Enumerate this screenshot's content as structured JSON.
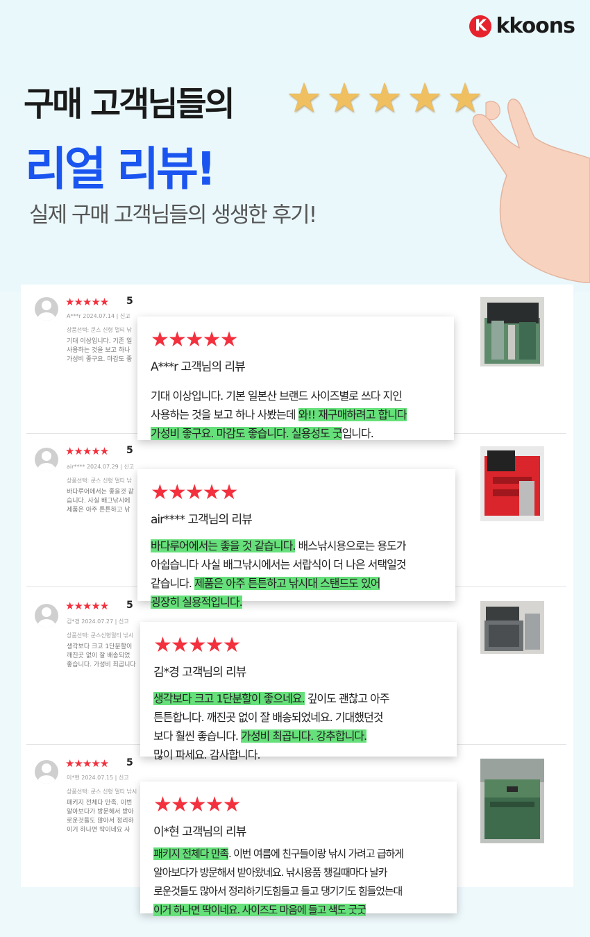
{
  "brand": {
    "logo_mark": "K",
    "logo_text": "kkoons"
  },
  "hero": {
    "headline_line1": "구매 고객님들의",
    "headline_line2": "리얼 리뷰!",
    "subheadline": "실제 구매 고객님들의 생생한 후기!",
    "gold_stars": "★★★★★"
  },
  "colors": {
    "accent_blue": "#1a55f0",
    "star_red": "#f3303d",
    "highlight_green": "#66e07a",
    "brand_red": "#e6232d"
  },
  "reviews": [
    {
      "list": {
        "stars": "★★★★★",
        "score": "5",
        "meta": "A***r  2024.07.14  |  신고",
        "option": "상품선택: 쿤스 신형 멀티 낚",
        "lines": [
          "기대 이상입니다. 기존 일",
          "사용하는 것을 보고 하나",
          "가성비 좋구요. 마감도 좋"
        ]
      },
      "card": {
        "stars": "★★★★★",
        "name": "A***r 고객님의 리뷰",
        "lines": [
          [
            {
              "t": "기대 이상입니다. 기본 일본산 브랜드 사이즈별로 쓰다 지인",
              "h": false
            }
          ],
          [
            {
              "t": "사용하는 것을 보고 하나 사봤는데 ",
              "h": false
            },
            {
              "t": "와!! 재구매하려고 합니다",
              "h": true
            }
          ],
          [
            {
              "t": "가성비 좋구요. 마감도 좋습니다. 실용성도 굿",
              "h": true
            },
            {
              "t": "입니다.",
              "h": false
            }
          ]
        ]
      },
      "thumb_icon": "tackle-box-photo-icon"
    },
    {
      "list": {
        "stars": "★★★★★",
        "score": "5",
        "meta": "air****  2024.07.29  |  신고",
        "option": "상품선택: 쿤스 신형 멀티 낚",
        "lines": [
          "바다루어에서는 좋을것 같",
          "습니다. 사실 배그낚시에",
          "제품은 아주 튼튼하고 낚"
        ]
      },
      "card": {
        "stars": "★★★★★",
        "name": "air****  고객님의 리뷰",
        "lines": [
          [
            {
              "t": "바다루어에서는 좋을 것 같습니다.",
              "h": true
            },
            {
              "t": " 배스낚시용으로는 용도가",
              "h": false
            }
          ],
          [
            {
              "t": "아쉽습니다 사실 배그낚시에서는 서랍식이 더 나은 서택일것",
              "h": false
            }
          ],
          [
            {
              "t": "같습니다. ",
              "h": false
            },
            {
              "t": "제품은 아주 튼튼하고 낚시대 스탠드도 있어",
              "h": true
            }
          ],
          [
            {
              "t": "굉장히 실용적입니다.",
              "h": true
            }
          ]
        ]
      },
      "thumb_icon": "red-tackle-box-photo-icon"
    },
    {
      "list": {
        "stars": "★★★★★",
        "score": "5",
        "meta": "김*경  2024.07.27  |  신고",
        "option": "상품선택: 쿤스신형멀티 낚시",
        "lines": [
          "생각보다 크고 1단분할이",
          "깨진곳 없이 잘 배송되었",
          "좋습니다. 가성비 최곱니다"
        ]
      },
      "card": {
        "stars": "★★★★★",
        "name": "김*경 고객님의 리뷰",
        "lines": [
          [
            {
              "t": "생각보다 크고 1단분할이 좋으네요.",
              "h": true
            },
            {
              "t": " 깊이도 괜찮고 아주",
              "h": false
            }
          ],
          [
            {
              "t": "튼튼합니다. 깨진곳 없이 잘 배송되었네요. 기대했던것",
              "h": false
            }
          ],
          [
            {
              "t": "보다 훨씬 좋습니다. ",
              "h": false
            },
            {
              "t": "가성비 최곱니다. 강추합니다.",
              "h": true
            }
          ],
          [
            {
              "t": "많이 파세요. 감사합니다.",
              "h": false
            }
          ]
        ]
      },
      "thumb_icon": "open-tackle-box-photo-icon"
    },
    {
      "list": {
        "stars": "★★★★★",
        "score": "5",
        "meta": "이*현  2024.07.15  |  신고",
        "option": "상품선택: 쿤스 신형 멀티 낚시",
        "lines": [
          "패키지 전체다 만족. 이번",
          "알아보다가 방문해서 받아",
          "로운것들도 많아서 정리하",
          "이거 하나면 딱이네요 사"
        ]
      },
      "card": {
        "stars": "★★★★★",
        "name": "이*현 고객님의 리뷰",
        "lines": [
          [
            {
              "t": "패키지 전체다 만족",
              "h": true
            },
            {
              "t": ". 이번 여름에 친구들이랑 낚시 가려고 급하게",
              "h": false
            }
          ],
          [
            {
              "t": "알아보다가 방문해서 받아왔네요. 낚시용품 챙길때마다 날카",
              "h": false
            }
          ],
          [
            {
              "t": "로운것들도 많아서 정리하기도힘들고 들고 댕기기도 힘들었는대",
              "h": false
            }
          ],
          [
            {
              "t": "이거 하나면 딱이네요. 사이즈도 마음에 들고 색도 굿굿",
              "h": true
            }
          ]
        ]
      },
      "thumb_icon": "green-tackle-box-photo-icon"
    }
  ]
}
